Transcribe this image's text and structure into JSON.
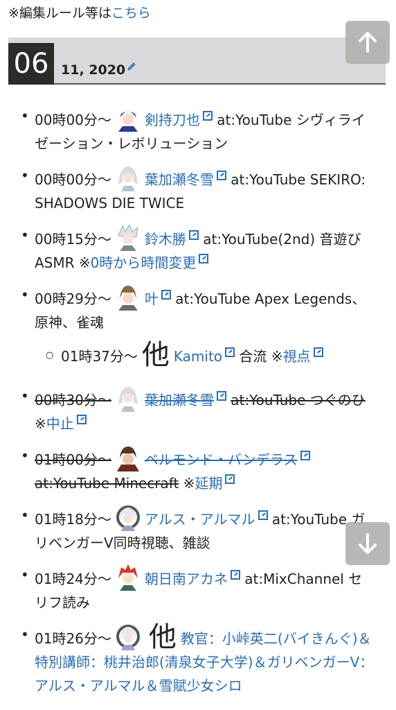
{
  "topnote": {
    "prefix": "※編集ルール等は",
    "link": "こちら"
  },
  "date": {
    "day": "06",
    "month_year": "11, 2020"
  },
  "entries": [
    {
      "time": "00時00分～",
      "name": "剣持刀也",
      "rest": "at:YouTube シヴィライゼーション・レボリューション"
    },
    {
      "time": "00時00分～",
      "name": "葉加瀬冬雪",
      "rest": "at:YouTube SEKIRO: SHADOWS DIE TWICE"
    },
    {
      "time": "00時15分～",
      "name": "鈴木勝",
      "rest": "at:YouTube(2nd) 音遊びASMR",
      "note_mark": "※",
      "note_link": "0時から時間変更"
    },
    {
      "time": "00時29分～",
      "name": "叶",
      "rest": "at:YouTube Apex Legends、原神、雀魂"
    },
    {
      "time": "01時37分～",
      "ta": "他",
      "name": "Kamito",
      "rest": "合流",
      "note_mark": "※",
      "note_link": "視点"
    },
    {
      "time": "00時30分～",
      "name": "葉加瀬冬雪",
      "rest": "at:YouTube つぐのひ",
      "note_mark": "※",
      "note_link": "中止"
    },
    {
      "time": "01時00分～",
      "name": "ベルモンド・バンデラス",
      "rest": "at:YouTube Minecraft",
      "note_mark": "※",
      "note_link": "延期"
    },
    {
      "time": "01時18分～",
      "name": "アルス・アルマル",
      "rest": "at:YouTube ガリベンガーV同時視聴、雑談"
    },
    {
      "time": "01時24分～",
      "name": "朝日南アカネ",
      "rest": "at:MixChannel セリフ読み"
    },
    {
      "time": "01時26分～",
      "ta": "他",
      "name": "教官：小峠英二(バイきんぐ)＆特別講師：桃井治郎(清泉女子大学)＆ガリベンガーV：アルス・アルマル＆雪賦少女シロ"
    }
  ],
  "icons": {
    "scroll_up": "arrow-up-icon",
    "scroll_down": "arrow-down-icon",
    "edit": "pencil-icon",
    "external": "external-link-icon"
  },
  "colors": {
    "link": "#2a6db5",
    "date_bar": "#d7d9dc",
    "day_box": "#2b2b2b",
    "scroll_button": "#b0b0b0"
  }
}
